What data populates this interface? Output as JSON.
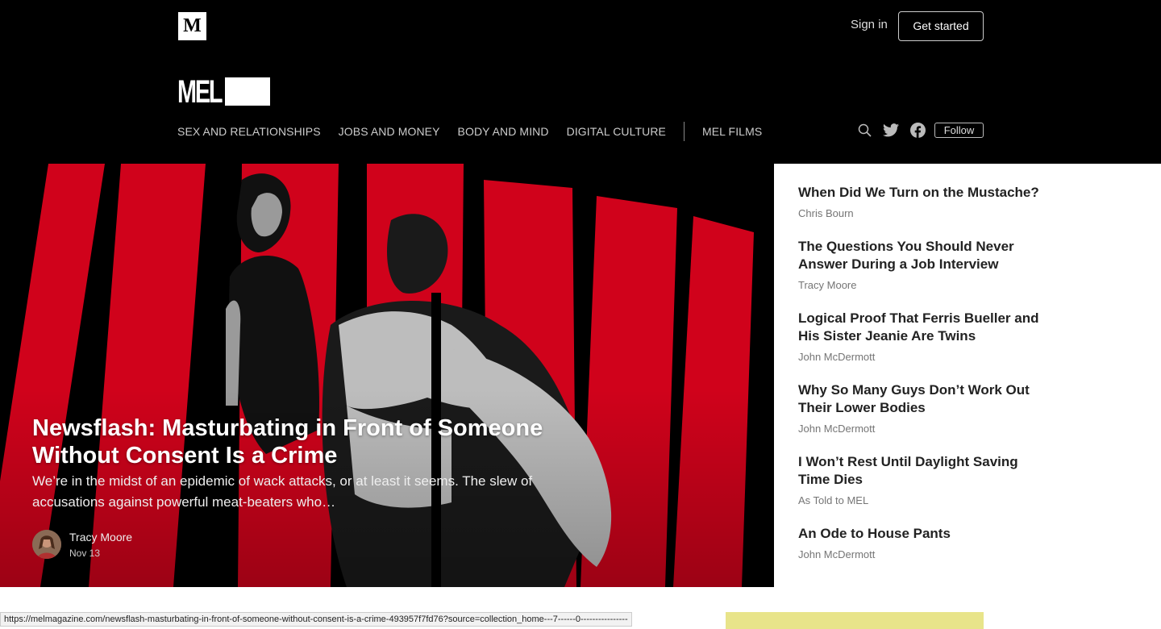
{
  "header": {
    "logo_letter": "M",
    "signin_label": "Sign in",
    "get_started_label": "Get started"
  },
  "publication": {
    "name": "MEL"
  },
  "nav": {
    "items": [
      "SEX AND RELATIONSHIPS",
      "JOBS AND MONEY",
      "BODY AND MIND",
      "DIGITAL CULTURE"
    ],
    "extra": "MEL FILMS",
    "follow_label": "Follow",
    "icons": [
      "search-icon",
      "twitter-icon",
      "facebook-icon"
    ]
  },
  "hero": {
    "title": "Newsflash: Masturbating in Front of Someone Without Consent Is a Crime",
    "subtitle": "We’re in the midst of an epidemic of wack attacks, or at least it seems. The slew of accusations against powerful meat-beaters who…",
    "author": "Tracy Moore",
    "date": "Nov 13",
    "accent": "#d0021b"
  },
  "sidebar": {
    "stories": [
      {
        "title": "When Did We Turn on the Mustache?",
        "author": "Chris Bourn"
      },
      {
        "title": "The Questions You Should Never Answer During a Job Interview",
        "author": "Tracy Moore"
      },
      {
        "title": "Logical Proof That Ferris Bueller and His Sister Jeanie Are Twins",
        "author": "John McDermott"
      },
      {
        "title": "Why So Many Guys Don’t Work Out Their Lower Bodies",
        "author": "John McDermott"
      },
      {
        "title": "I Won’t Rest Until Daylight Saving Time Dies",
        "author": "As Told to MEL"
      },
      {
        "title": "An Ode to House Pants",
        "author": "John McDermott"
      }
    ]
  },
  "status_bar": {
    "url": "https://melmagazine.com/newsflash-masturbating-in-front-of-someone-without-consent-is-a-crime-493957f7fd76?source=collection_home---7------0----------------"
  }
}
